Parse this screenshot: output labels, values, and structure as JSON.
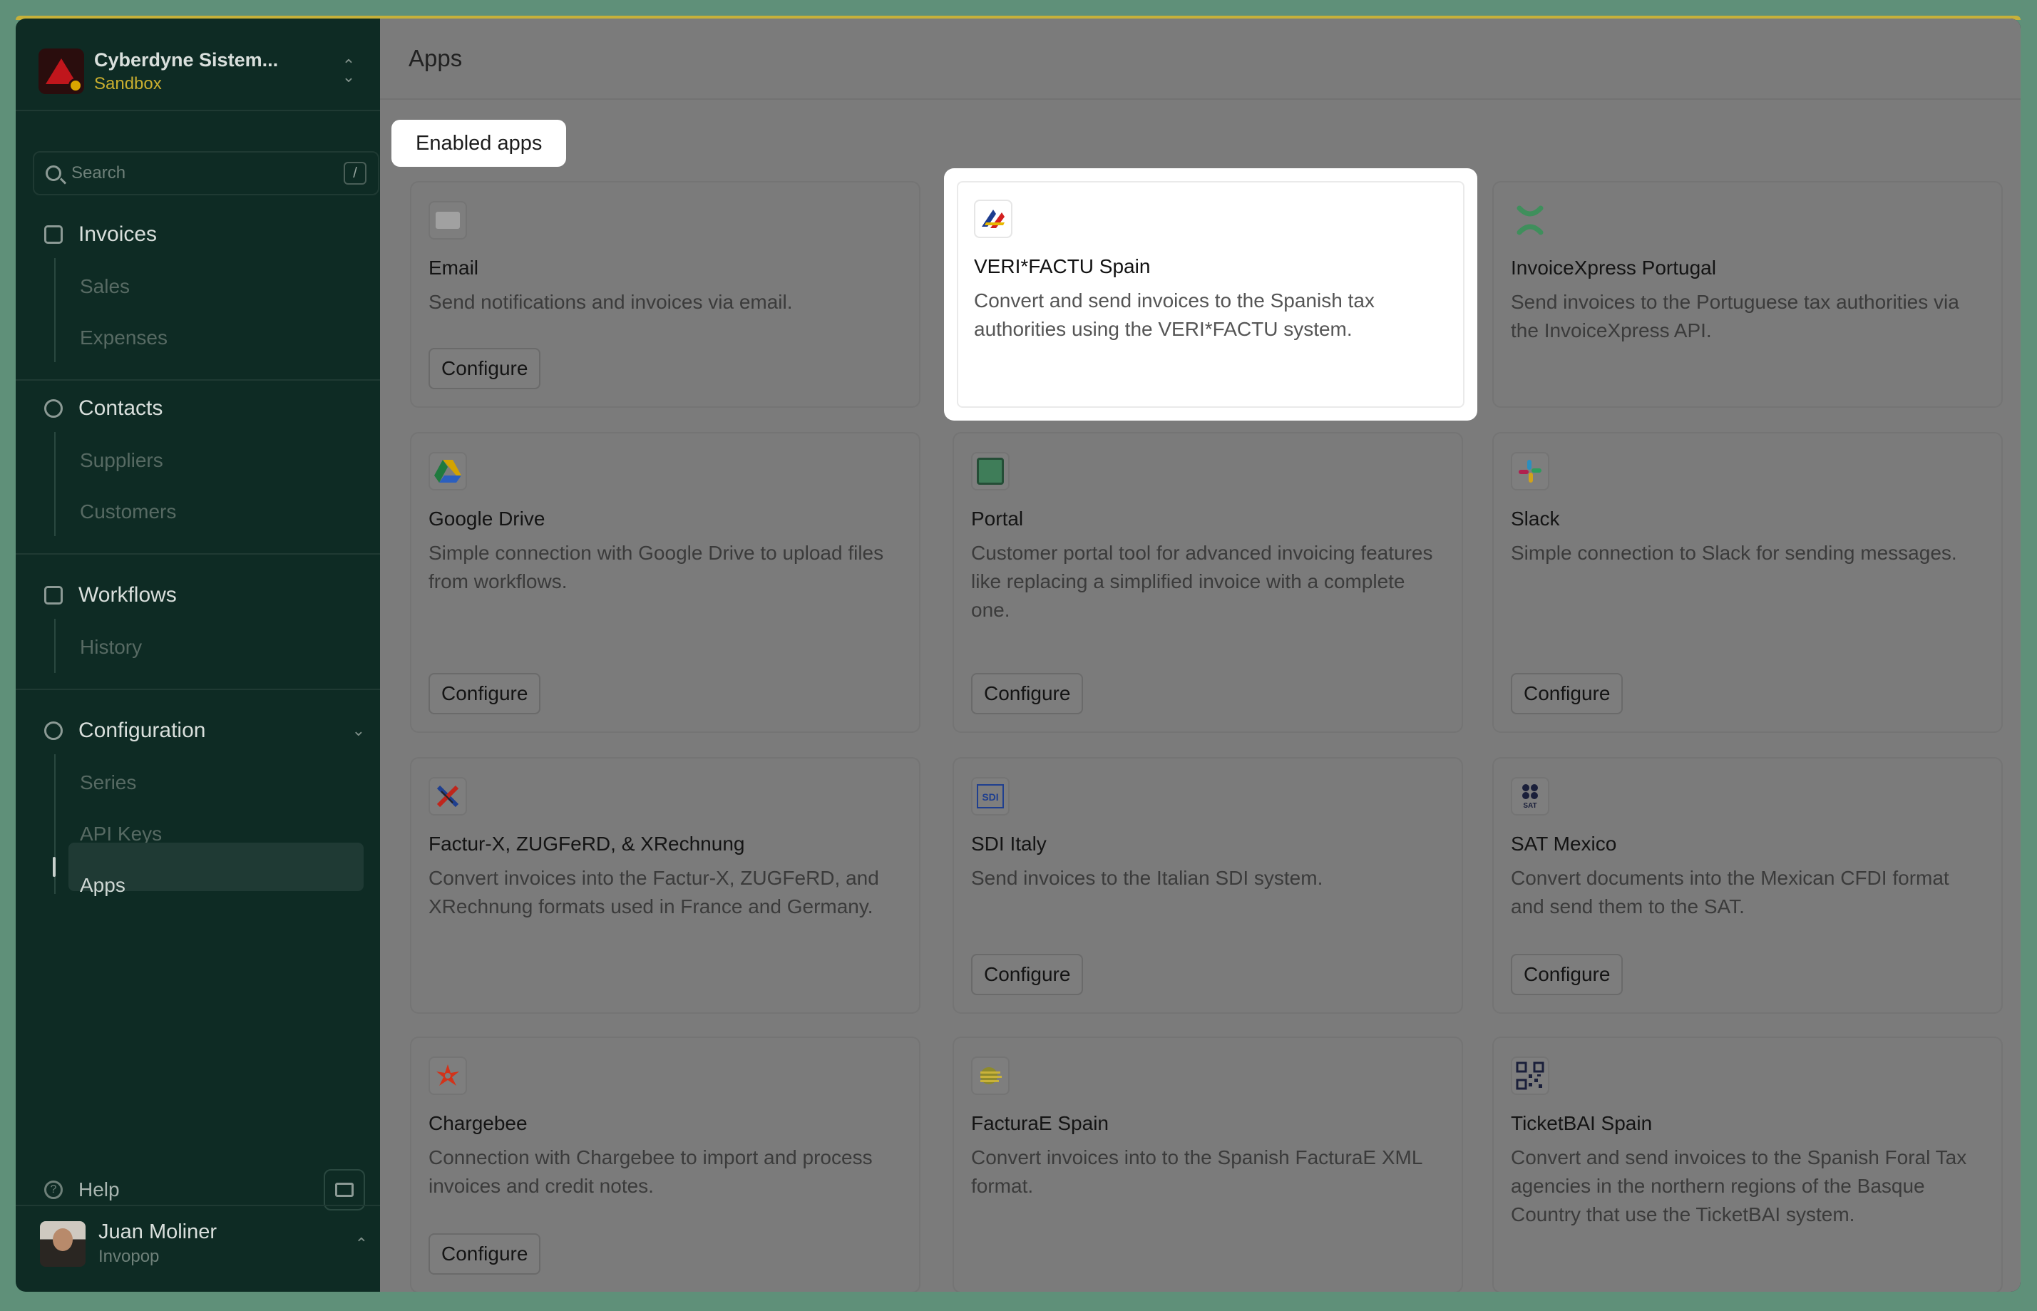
{
  "sidebar": {
    "org_name": "Cyberdyne Sistem...",
    "org_env": "Sandbox",
    "search_placeholder": "Search",
    "search_shortcut": "/",
    "sections": [
      {
        "label": "Invoices",
        "icon": "invoice-icon",
        "items": [
          "Sales",
          "Expenses"
        ]
      },
      {
        "label": "Contacts",
        "icon": "person-icon",
        "items": [
          "Suppliers",
          "Customers"
        ]
      },
      {
        "label": "Workflows",
        "icon": "workflow-icon",
        "items": [
          "History"
        ]
      },
      {
        "label": "Configuration",
        "icon": "gear-icon",
        "items": [
          "Series",
          "API Keys",
          "Apps"
        ]
      }
    ],
    "active_item": "Apps",
    "help_label": "Help",
    "user_name": "Juan Moliner",
    "user_org": "Invopop"
  },
  "main": {
    "title": "Apps",
    "tab_label": "Enabled apps",
    "configure_label": "Configure",
    "apps": [
      {
        "name": "Email",
        "desc": "Send notifications and invoices via email.",
        "icon": "mail-icon",
        "configure": true
      },
      {
        "name": "VERI*FACTU Spain",
        "desc": "Convert and send invoices to the Spanish tax authorities using the VERI*FACTU system.",
        "icon": "aeat-logo-icon",
        "configure": false,
        "highlighted": true
      },
      {
        "name": "InvoiceXpress Portugal",
        "desc": "Send invoices to the Portuguese tax authorities via the InvoiceXpress API.",
        "icon": "invoicexpress-x-icon",
        "configure": false
      },
      {
        "name": "Google Drive",
        "desc": "Simple connection with Google Drive to upload files from workflows.",
        "icon": "google-drive-icon",
        "configure": true
      },
      {
        "name": "Portal",
        "desc": "Customer portal tool for advanced invoicing features like replacing a simplified invoice with a complete one.",
        "icon": "portal-square-icon",
        "configure": true
      },
      {
        "name": "Slack",
        "desc": "Simple connection to Slack for sending messages.",
        "icon": "slack-icon",
        "configure": true
      },
      {
        "name": "Factur-X, ZUGFeRD, & XRechnung",
        "desc": "Convert invoices into the Factur-X, ZUGFeRD, and XRechnung formats used in France and Germany.",
        "icon": "facturx-x-icon",
        "configure": false
      },
      {
        "name": "SDI Italy",
        "desc": "Send invoices to the Italian SDI system.",
        "icon": "sdi-icon",
        "configure": true
      },
      {
        "name": "SAT Mexico",
        "desc": "Convert documents into the Mexican CFDI format and send them to the SAT.",
        "icon": "sat-icon",
        "configure": true
      },
      {
        "name": "Chargebee",
        "desc": "Connection with Chargebee to import and process invoices and credit notes.",
        "icon": "chargebee-icon",
        "configure": true
      },
      {
        "name": "FacturaE Spain",
        "desc": "Convert invoices into to the Spanish FacturaE XML format.",
        "icon": "facturae-icon",
        "configure": false
      },
      {
        "name": "TicketBAI Spain",
        "desc": "Convert and send invoices to the Spanish Foral Tax agencies in the northern regions of the Basque Country that use the TicketBAI system.",
        "icon": "qr-code-icon",
        "configure": false
      }
    ]
  },
  "colors": {
    "sidebar_bg": "#0e2b24",
    "sandbox_accent": "#c9ae2f",
    "overlay_bg": "#7b7b7b",
    "highlight_bg": "#ffffff"
  }
}
